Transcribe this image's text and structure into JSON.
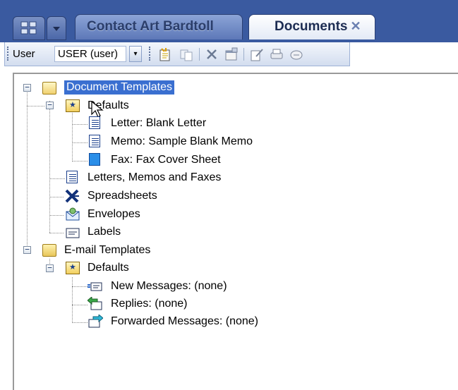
{
  "tabs": [
    {
      "label": "Contact Art Bardtoll",
      "active": false
    },
    {
      "label": "Documents",
      "active": true,
      "close": "✕"
    }
  ],
  "toolbar": {
    "user_label": "User",
    "user_value": "USER (user)",
    "dropdown_arrow": "▾",
    "icons": [
      "new-template-icon",
      "copy-icon",
      "delete-icon",
      "properties-icon",
      "edit-icon",
      "print-icon",
      "merge-icon"
    ]
  },
  "tree": {
    "document_templates": "Document Templates",
    "defaults_1": "Defaults",
    "letter_blank": "Letter: Blank Letter",
    "memo_blank": "Memo: Sample Blank Memo",
    "fax_cover": "Fax: Fax Cover Sheet",
    "letters_memos_faxes": "Letters, Memos and Faxes",
    "spreadsheets": "Spreadsheets",
    "envelopes": "Envelopes",
    "labels": "Labels",
    "email_templates": "E-mail Templates",
    "defaults_2": "Defaults",
    "new_messages": "New Messages: (none)",
    "replies": "Replies: (none)",
    "forwarded": "Forwarded Messages: (none)",
    "minus": "−"
  },
  "colors": {
    "header_blue": "#3a5aa0",
    "selection": "#3a6fd0"
  }
}
